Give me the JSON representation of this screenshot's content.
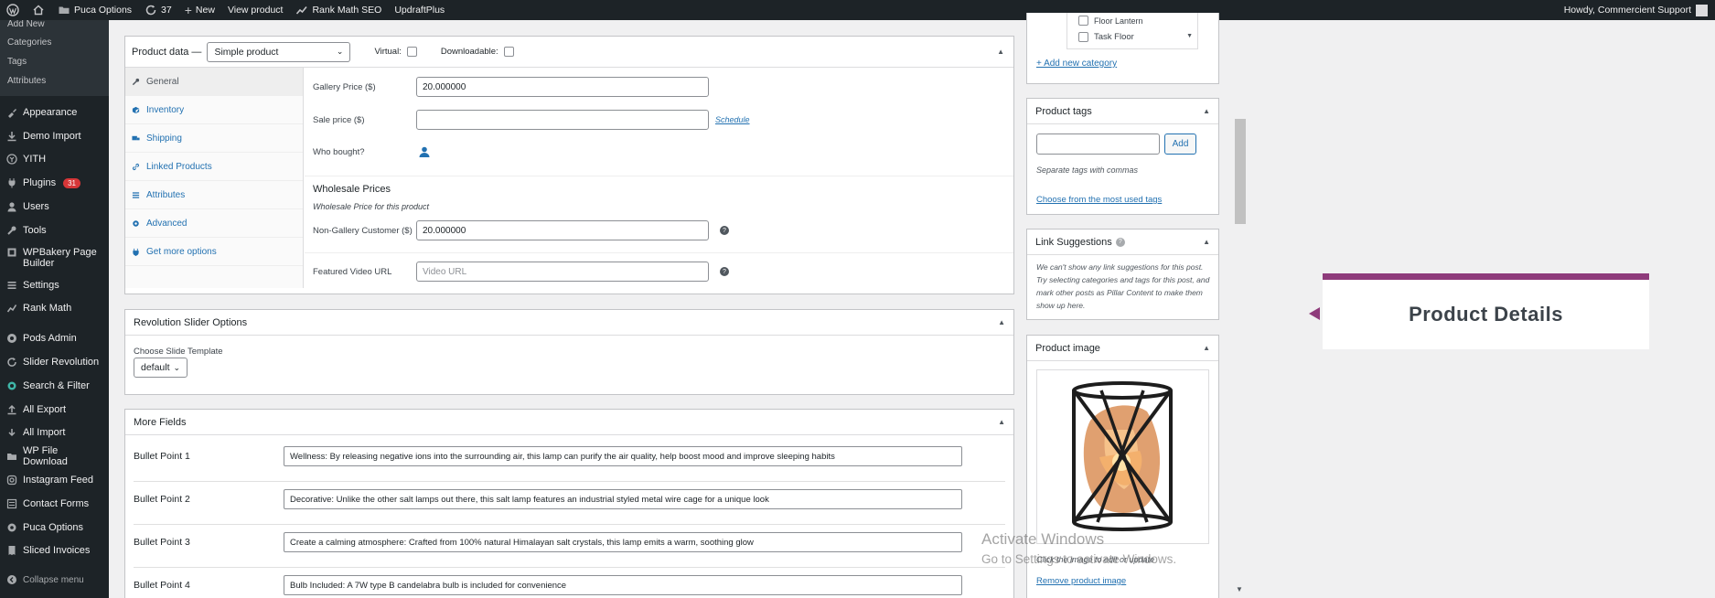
{
  "admin_bar": {
    "site_name": "Puca Options",
    "updates_count": "37",
    "new_label": "New",
    "view_product_label": "View product",
    "rank_math_label": "Rank Math SEO",
    "updraft_label": "UpdraftPlus",
    "howdy_label": "Howdy, Commercient Support"
  },
  "sidebar": {
    "sub_items": [
      "Add New",
      "Categories",
      "Tags",
      "Attributes"
    ],
    "menu": [
      {
        "label": "Appearance",
        "icon": "brush-icon"
      },
      {
        "label": "Demo Import",
        "icon": "import-icon"
      },
      {
        "label": "YITH",
        "icon": "yith-icon"
      },
      {
        "label": "Plugins",
        "icon": "plug-icon",
        "badge": "31"
      },
      {
        "label": "Users",
        "icon": "user-icon"
      },
      {
        "label": "Tools",
        "icon": "wrench-icon"
      },
      {
        "label": "WPBakery Page Builder",
        "icon": "builder-icon"
      },
      {
        "label": "Settings",
        "icon": "settings-icon"
      },
      {
        "label": "Rank Math",
        "icon": "rankmath-icon"
      },
      {
        "label": "Pods Admin",
        "icon": "pods-icon"
      },
      {
        "label": "Slider Revolution",
        "icon": "refresh-icon"
      },
      {
        "label": "Search & Filter",
        "icon": "filter-icon"
      },
      {
        "label": "All Export",
        "icon": "export-icon"
      },
      {
        "label": "All Import",
        "icon": "import-arrow-icon"
      },
      {
        "label": "WP File Download",
        "icon": "folder-icon"
      },
      {
        "label": "Instagram Feed",
        "icon": "instagram-icon"
      },
      {
        "label": "Contact Forms",
        "icon": "form-icon"
      },
      {
        "label": "Puca Options",
        "icon": "gear-icon"
      },
      {
        "label": "Sliced Invoices",
        "icon": "invoice-icon"
      }
    ],
    "collapse_label": "Collapse menu"
  },
  "product_data": {
    "title": "Product data —",
    "type_value": "Simple product",
    "virtual_label": "Virtual:",
    "downloadable_label": "Downloadable:",
    "tabs": [
      "General",
      "Inventory",
      "Shipping",
      "Linked Products",
      "Attributes",
      "Advanced",
      "Get more options"
    ],
    "gallery_price_label": "Gallery Price ($)",
    "gallery_price_value": "20.000000",
    "sale_price_label": "Sale price ($)",
    "sale_price_value": "",
    "schedule_label": "Schedule",
    "who_bought_label": "Who bought?",
    "wholesale_title": "Wholesale Prices",
    "wholesale_sub": "Wholesale Price for this product",
    "non_gallery_label": "Non-Gallery Customer ($)",
    "non_gallery_value": "20.000000",
    "featured_video_label": "Featured Video URL",
    "featured_video_placeholder": "Video URL"
  },
  "revolution": {
    "title": "Revolution Slider Options",
    "choose_label": "Choose Slide Template",
    "select_value": "default"
  },
  "more_fields": {
    "title": "More Fields",
    "rows": [
      {
        "label": "Bullet Point 1",
        "value": "Wellness: By releasing negative ions into the surrounding air, this lamp can purify the air quality, help boost mood and improve sleeping habits"
      },
      {
        "label": "Bullet Point 2",
        "value": "Decorative: Unlike the other salt lamps out there, this salt lamp features an industrial styled metal wire cage for a unique look"
      },
      {
        "label": "Bullet Point 3",
        "value": "Create a calming atmosphere: Crafted from 100% natural Himalayan salt crystals, this lamp emits a warm, soothing glow"
      },
      {
        "label": "Bullet Point 4",
        "value": "Bulb Included: A 7W type B candelabra bulb is included for convenience"
      }
    ]
  },
  "categories": {
    "items": [
      "Floor Lantern",
      "Task Floor"
    ],
    "add_new_label": "+ Add new category"
  },
  "product_tags": {
    "title": "Product tags",
    "add_button": "Add",
    "hint": "Separate tags with commas",
    "choose_link": "Choose from the most used tags"
  },
  "link_suggestions": {
    "title": "Link Suggestions",
    "text": "We can't show any link suggestions for this post. Try selecting categories and tags for this post, and mark other posts as Pillar Content to make them show up here."
  },
  "product_image": {
    "title": "Product image",
    "caption": "Click the image to edit or update",
    "remove_link": "Remove product image"
  },
  "popup": {
    "title": "Product Details"
  },
  "watermark": {
    "line1": "Activate Windows",
    "line2": "Go to Settings to activate Windows."
  },
  "colors": {
    "admin_dark": "#1d2327",
    "link_blue": "#2271b1",
    "popup_accent": "#8e3b7b",
    "badge_red": "#d63638"
  }
}
